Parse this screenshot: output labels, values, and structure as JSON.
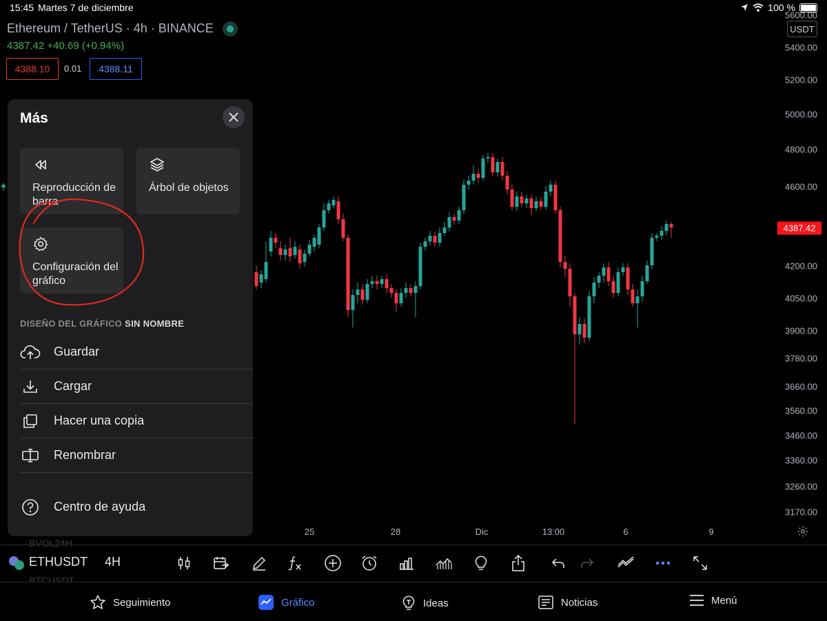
{
  "status_bar": {
    "time": "15:45",
    "date": "Martes 7 de diciembre",
    "battery": "100 %"
  },
  "header": {
    "symbol_line": "Ethereum / TetherUS · 4h · BINANCE",
    "price_change": "4387.42  +40.69 (+0.94%)",
    "bid": "4388.10",
    "spread": "0.01",
    "ask": "4388.11",
    "currency": "USDT"
  },
  "price_axis": {
    "labels": [
      "5600.00",
      "5400.00",
      "5200.00",
      "5000.00",
      "4800.00",
      "4600.00",
      "4200.00",
      "4050.00",
      "3900.00",
      "3780.00",
      "3660.00",
      "3560.00",
      "3460.00",
      "3360.00",
      "3260.00",
      "3170.00"
    ],
    "current_price": "4387.42"
  },
  "time_axis": {
    "labels": [
      "25",
      "28",
      "Dic",
      "13:00",
      "6",
      "9"
    ]
  },
  "panel": {
    "title": "Más",
    "tiles": [
      {
        "label": "Reproducción de barra",
        "icon": "rewind-icon"
      },
      {
        "label": "Árbol de objetos",
        "icon": "layers-icon"
      },
      {
        "label": "Configuración del gráfico",
        "icon": "gear-icon"
      }
    ],
    "section_label": "DISEÑO DEL GRÁFICO",
    "section_name": "SIN NOMBRE",
    "items": [
      {
        "label": "Guardar",
        "icon": "cloud-upload-icon"
      },
      {
        "label": "Cargar",
        "icon": "download-icon"
      },
      {
        "label": "Hacer una copia",
        "icon": "copy-icon"
      },
      {
        "label": "Renombrar",
        "icon": "rename-icon"
      },
      {
        "label": "Centro de ayuda",
        "icon": "help-icon"
      }
    ]
  },
  "background_labels": {
    "a": "BVOL24H",
    "b": "BTCUSDT"
  },
  "toolbar": {
    "symbol": "ETHUSDT",
    "timeframe": "4H"
  },
  "nav": {
    "items": [
      {
        "label": "Seguimiento",
        "icon": "star-icon"
      },
      {
        "label": "Gráfico",
        "icon": "chart-icon"
      },
      {
        "label": "Ideas",
        "icon": "idea-icon"
      },
      {
        "label": "Noticias",
        "icon": "news-icon"
      },
      {
        "label": "Menú",
        "icon": "menu-icon"
      }
    ]
  },
  "colors": {
    "up": "#26a69a",
    "down": "#f23645",
    "accent": "#2962ff",
    "annotation": "#e0281e"
  }
}
